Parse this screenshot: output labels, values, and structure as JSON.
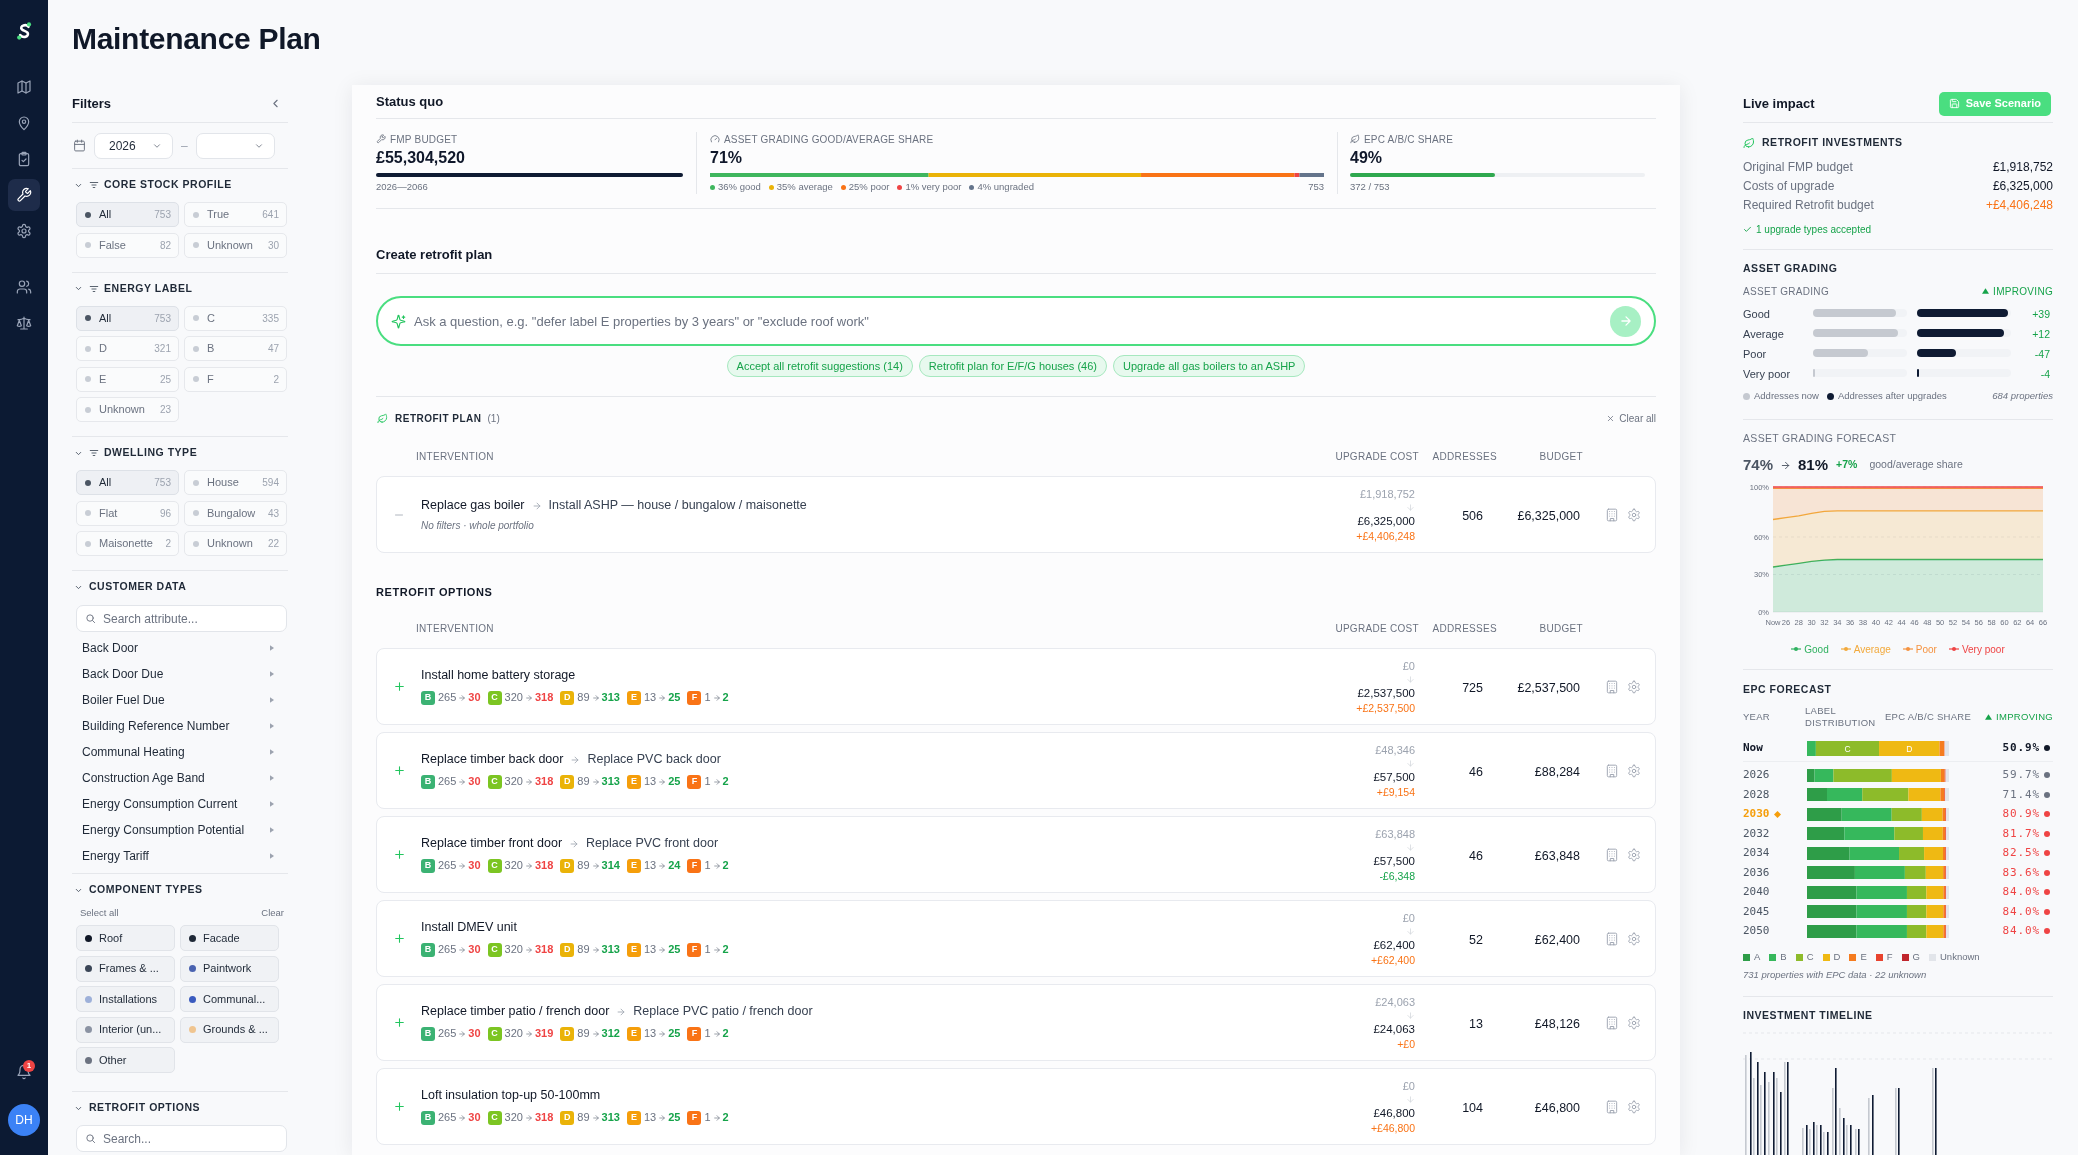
{
  "nav": {
    "groups": [
      [
        {
          "selected": false
        },
        {
          "selected": false
        },
        {
          "selected": false
        },
        {
          "selected": true
        },
        {
          "selected": false
        }
      ],
      [
        {
          "selected": false
        },
        {
          "selected": false
        }
      ]
    ],
    "notifications": "1",
    "avatar": "DH"
  },
  "page_title": "Maintenance Plan",
  "filters": {
    "title": "Filters",
    "year_from": "2026",
    "separator": "–",
    "sections": [
      {
        "kind": "chips",
        "title": "CORE STOCK PROFILE",
        "expanded": true,
        "options": [
          {
            "label": "All",
            "count": "753",
            "selected": true
          },
          {
            "label": "True",
            "count": "641",
            "selected": false
          },
          {
            "label": "False",
            "count": "82",
            "selected": false
          },
          {
            "label": "Unknown",
            "count": "30",
            "selected": false
          }
        ]
      },
      {
        "kind": "chips",
        "title": "ENERGY LABEL",
        "expanded": true,
        "options": [
          {
            "label": "All",
            "count": "753",
            "selected": true
          },
          {
            "label": "C",
            "count": "335",
            "selected": false
          },
          {
            "label": "D",
            "count": "321",
            "selected": false
          },
          {
            "label": "B",
            "count": "47",
            "selected": false
          },
          {
            "label": "E",
            "count": "25",
            "selected": false
          },
          {
            "label": "F",
            "count": "2",
            "selected": false
          },
          {
            "label": "Unknown",
            "count": "23",
            "selected": false
          }
        ]
      },
      {
        "kind": "chips",
        "title": "DWELLING TYPE",
        "expanded": true,
        "options": [
          {
            "label": "All",
            "count": "753",
            "selected": true
          },
          {
            "label": "House",
            "count": "594",
            "selected": false
          },
          {
            "label": "Flat",
            "count": "96",
            "selected": false
          },
          {
            "label": "Bungalow",
            "count": "43",
            "selected": false
          },
          {
            "label": "Maisonette",
            "count": "2",
            "selected": false
          },
          {
            "label": "Unknown",
            "count": "22",
            "selected": false
          }
        ]
      },
      {
        "kind": "attributes",
        "title": "CUSTOMER DATA",
        "expanded": true,
        "search": {
          "placeholder": "Search attribute..."
        },
        "items": [
          "Back Door",
          "Back Door Due",
          "Boiler Fuel Due",
          "Building Reference Number",
          "Communal Heating",
          "Construction Age Band",
          "Energy Consumption Current",
          "Energy Consumption Potential",
          "Energy Tariff"
        ]
      },
      {
        "kind": "components",
        "title": "COMPONENT TYPES",
        "expanded": true,
        "select_all": "Select all",
        "clear": "Clear",
        "options": [
          {
            "label": "Roof",
            "color": "#111827",
            "selected": true
          },
          {
            "label": "Facade",
            "color": "#1f2937",
            "selected": true
          },
          {
            "label": "Frames & ...",
            "color": "#3b4657",
            "selected": true
          },
          {
            "label": "Paintwork",
            "color": "#4a63b0",
            "selected": true
          },
          {
            "label": "Installations",
            "color": "#9db0d9",
            "selected": true
          },
          {
            "label": "Communal...",
            "color": "#3a5bbf",
            "selected": true
          },
          {
            "label": "Interior (un...",
            "color": "#8b93a3",
            "selected": true
          },
          {
            "label": "Grounds & ...",
            "color": "#f0c590",
            "selected": true
          },
          {
            "label": "Other",
            "color": "#6b7280",
            "selected": true
          }
        ]
      },
      {
        "kind": "search",
        "title": "RETROFIT OPTIONS",
        "expanded": true,
        "search": {
          "placeholder": "Search..."
        }
      }
    ]
  },
  "status_quo": {
    "title": "Status quo",
    "kpis": [
      {
        "kind": "budget",
        "label": "FMP BUDGET",
        "value": "£55,304,520",
        "note": "2026—2066"
      },
      {
        "kind": "grading",
        "label": "ASSET GRADING GOOD/AVERAGE SHARE",
        "value": "71%",
        "legend": [
          {
            "label": "36% good",
            "color": "#3fb65e"
          },
          {
            "label": "35% average",
            "color": "#eab308"
          },
          {
            "label": "25% poor",
            "color": "#f97316"
          },
          {
            "label": "1% very poor",
            "color": "#ef4444"
          },
          {
            "label": "4% ungraded",
            "color": "#64748b"
          }
        ],
        "total": "753"
      },
      {
        "kind": "share",
        "label": "EPC A/B/C SHARE",
        "value": "49%",
        "level": 0.49,
        "note": "372 / 753"
      }
    ]
  },
  "create_plan": {
    "title": "Create retrofit plan",
    "prompt": {
      "placeholder": "Ask a question, e.g. \"defer label E properties by 3 years\" or \"exclude roof work\""
    },
    "suggestions": [
      "Accept all retrofit suggestions (14)",
      "Retrofit plan for E/F/G houses (46)",
      "Upgrade all gas boilers to an ASHP"
    ]
  },
  "retrofit_plan": {
    "title": "RETROFIT PLAN",
    "count": "(1)",
    "clear": "Clear all",
    "columns": [
      "INTERVENTION",
      "UPGRADE COST",
      "ADDRESSES",
      "BUDGET"
    ],
    "rows": [
      {
        "accepted": true,
        "title": "Replace gas boiler",
        "replacement": "Install ASHP — house / bungalow / maisonette",
        "note": "No filters · whole portfolio",
        "cost_from": "£1,918,752",
        "cost_to": "£6,325,000",
        "delta": {
          "text": "+£4,406,248",
          "increase": true
        },
        "addresses": "506",
        "budget": "£6,325,000"
      }
    ]
  },
  "retrofit_options": {
    "title": "RETROFIT OPTIONS",
    "columns": [
      "INTERVENTION",
      "UPGRADE COST",
      "ADDRESSES",
      "BUDGET"
    ],
    "rows": [
      {
        "accepted": false,
        "title": "Install home battery storage",
        "label_changes": [
          {
            "label": "B",
            "color": "#3bb273",
            "from": "265",
            "to": "30",
            "increase": false
          },
          {
            "label": "C",
            "color": "#7cc522",
            "from": "320",
            "to": "318",
            "increase": false
          },
          {
            "label": "D",
            "color": "#eab308",
            "from": "89",
            "to": "313",
            "increase": true
          },
          {
            "label": "E",
            "color": "#f59e0b",
            "from": "13",
            "to": "25",
            "increase": true
          },
          {
            "label": "F",
            "color": "#f97316",
            "from": "1",
            "to": "2",
            "increase": true
          }
        ],
        "cost_from": "£0",
        "cost_to": "£2,537,500",
        "delta": {
          "text": "+£2,537,500",
          "increase": true
        },
        "addresses": "725",
        "budget": "£2,537,500"
      },
      {
        "accepted": false,
        "title": "Replace timber back door",
        "replacement": "Replace PVC back door",
        "label_changes": [
          {
            "label": "B",
            "color": "#3bb273",
            "from": "265",
            "to": "30",
            "increase": false
          },
          {
            "label": "C",
            "color": "#7cc522",
            "from": "320",
            "to": "318",
            "increase": false
          },
          {
            "label": "D",
            "color": "#eab308",
            "from": "89",
            "to": "313",
            "increase": true
          },
          {
            "label": "E",
            "color": "#f59e0b",
            "from": "13",
            "to": "25",
            "increase": true
          },
          {
            "label": "F",
            "color": "#f97316",
            "from": "1",
            "to": "2",
            "increase": true
          }
        ],
        "cost_from": "£48,346",
        "cost_to": "£57,500",
        "delta": {
          "text": "+£9,154",
          "increase": true
        },
        "addresses": "46",
        "budget": "£88,284"
      },
      {
        "accepted": false,
        "title": "Replace timber front door",
        "replacement": "Replace PVC front door",
        "label_changes": [
          {
            "label": "B",
            "color": "#3bb273",
            "from": "265",
            "to": "30",
            "increase": false
          },
          {
            "label": "C",
            "color": "#7cc522",
            "from": "320",
            "to": "318",
            "increase": false
          },
          {
            "label": "D",
            "color": "#eab308",
            "from": "89",
            "to": "314",
            "increase": true
          },
          {
            "label": "E",
            "color": "#f59e0b",
            "from": "13",
            "to": "24",
            "increase": true
          },
          {
            "label": "F",
            "color": "#f97316",
            "from": "1",
            "to": "2",
            "increase": true
          }
        ],
        "cost_from": "£63,848",
        "cost_to": "£57,500",
        "delta": {
          "text": "-£6,348",
          "increase": false
        },
        "addresses": "46",
        "budget": "£63,848"
      },
      {
        "accepted": false,
        "title": "Install DMEV unit",
        "label_changes": [
          {
            "label": "B",
            "color": "#3bb273",
            "from": "265",
            "to": "30",
            "increase": false
          },
          {
            "label": "C",
            "color": "#7cc522",
            "from": "320",
            "to": "318",
            "increase": false
          },
          {
            "label": "D",
            "color": "#eab308",
            "from": "89",
            "to": "313",
            "increase": true
          },
          {
            "label": "E",
            "color": "#f59e0b",
            "from": "13",
            "to": "25",
            "increase": true
          },
          {
            "label": "F",
            "color": "#f97316",
            "from": "1",
            "to": "2",
            "increase": true
          }
        ],
        "cost_from": "£0",
        "cost_to": "£62,400",
        "delta": {
          "text": "+£62,400",
          "increase": true
        },
        "addresses": "52",
        "budget": "£62,400"
      },
      {
        "accepted": false,
        "title": "Replace timber patio / french door",
        "replacement": "Replace PVC patio / french door",
        "label_changes": [
          {
            "label": "B",
            "color": "#3bb273",
            "from": "265",
            "to": "30",
            "increase": false
          },
          {
            "label": "C",
            "color": "#7cc522",
            "from": "320",
            "to": "319",
            "increase": false
          },
          {
            "label": "D",
            "color": "#eab308",
            "from": "89",
            "to": "312",
            "increase": true
          },
          {
            "label": "E",
            "color": "#f59e0b",
            "from": "13",
            "to": "25",
            "increase": true
          },
          {
            "label": "F",
            "color": "#f97316",
            "from": "1",
            "to": "2",
            "increase": true
          }
        ],
        "cost_from": "£24,063",
        "cost_to": "£24,063",
        "delta": {
          "text": "+£0",
          "increase": true
        },
        "addresses": "13",
        "budget": "£48,126"
      },
      {
        "accepted": false,
        "title": "Loft insulation top-up 50-100mm",
        "label_changes": [
          {
            "label": "B",
            "color": "#3bb273",
            "from": "265",
            "to": "30",
            "increase": false
          },
          {
            "label": "C",
            "color": "#7cc522",
            "from": "320",
            "to": "318",
            "increase": false
          },
          {
            "label": "D",
            "color": "#eab308",
            "from": "89",
            "to": "313",
            "increase": true
          },
          {
            "label": "E",
            "color": "#f59e0b",
            "from": "13",
            "to": "25",
            "increase": true
          },
          {
            "label": "F",
            "color": "#f97316",
            "from": "1",
            "to": "2",
            "increase": true
          }
        ],
        "cost_from": "£0",
        "cost_to": "£46,800",
        "delta": {
          "text": "+£46,800",
          "increase": true
        },
        "addresses": "104",
        "budget": "£46,800"
      }
    ]
  },
  "live_impact": {
    "title": "Live impact",
    "save_button": "Save Scenario",
    "investments": {
      "title": "RETROFIT INVESTMENTS",
      "rows": [
        {
          "kind": "plain",
          "label": "Original FMP budget",
          "value": "£1,918,752"
        },
        {
          "kind": "plain",
          "label": "Costs of upgrade",
          "value": "£6,325,000"
        },
        {
          "kind": "increase",
          "label": "Required Retrofit budget",
          "value": "+£4,406,248"
        }
      ],
      "note": "1 upgrade types accepted"
    },
    "asset_grading": {
      "title": "ASSET GRADING",
      "subtitle": "ASSET GRADING",
      "trend": "IMPROVING",
      "rows": [
        {
          "label": "Good",
          "now": {
            "level": 0.88
          },
          "after": {
            "level": 0.97
          },
          "delta": "+39"
        },
        {
          "label": "Average",
          "now": {
            "level": 0.9
          },
          "after": {
            "level": 0.93
          },
          "delta": "+12"
        },
        {
          "label": "Poor",
          "now": {
            "level": 0.59
          },
          "after": {
            "level": 0.42
          },
          "delta": "-47"
        },
        {
          "label": "Very poor",
          "now": {
            "level": 0.02
          },
          "after": {
            "level": 0.02
          },
          "delta": "-4"
        }
      ],
      "legend": [
        "Addresses now",
        "Addresses after upgrades"
      ],
      "properties": "684 properties"
    },
    "forecast": {
      "title": "ASSET GRADING FORECAST",
      "from": "74%",
      "to": "81%",
      "change": "+7%",
      "caption": "good/average share",
      "chart_data": {
        "type": "area",
        "stacked": true,
        "legend": "bottom",
        "categories": [
          "Now",
          "26",
          "28",
          "30",
          "32",
          "34",
          "36",
          "38",
          "40",
          "42",
          "44",
          "46",
          "48",
          "50",
          "52",
          "54",
          "56",
          "58",
          "60",
          "62",
          "64",
          "66"
        ],
        "ylim": [
          0,
          100
        ],
        "yticks": [
          {
            "value": 0,
            "label": "0%"
          },
          {
            "value": 30,
            "label": "30%"
          },
          {
            "value": 60,
            "label": "60%"
          },
          {
            "value": 100,
            "label": "100%"
          }
        ],
        "series": [
          {
            "name": "Good",
            "color": "#2fb15f",
            "values": [
              36,
              37.5,
              39,
              40.5,
              41.5,
              42,
              42,
              42,
              42,
              42,
              42,
              42,
              42,
              42,
              42,
              42,
              42,
              42,
              42,
              42,
              42,
              42
            ]
          },
          {
            "name": "Average",
            "color": "#f2a93b",
            "values": [
              38,
              38,
              38,
              38.5,
              39,
              39,
              39,
              39,
              39,
              39,
              39,
              39,
              39,
              39,
              39,
              39,
              39,
              39,
              39,
              39,
              39,
              39
            ]
          },
          {
            "name": "Poor",
            "color": "#f59340",
            "values": [
              25,
              23.5,
              22,
              20,
              18.5,
              18,
              18,
              18,
              18,
              18,
              18,
              18,
              18,
              18,
              18,
              18,
              18,
              18,
              18,
              18,
              18,
              18
            ]
          },
          {
            "name": "Very poor",
            "color": "#ef4444",
            "values": [
              1,
              1,
              1,
              1,
              1,
              1,
              1,
              1,
              1,
              1,
              1,
              1,
              1,
              1,
              1,
              1,
              1,
              1,
              1,
              1,
              1,
              1
            ]
          }
        ]
      }
    },
    "epc_forecast": {
      "title": "EPC FORECAST",
      "columns": [
        "YEAR",
        "LABEL DISTRIBUTION",
        "EPC A/B/C SHARE"
      ],
      "trend": "IMPROVING",
      "rows": [
        {
          "kind": "current",
          "year": "Now",
          "selected": false,
          "bar_labels": [
            "C",
            "D"
          ],
          "share": "50.9%",
          "color": "#111827"
        },
        {
          "kind": "forecast",
          "year": "2026",
          "selected": false,
          "share": "59.7%",
          "color": "#6b7280"
        },
        {
          "kind": "forecast",
          "year": "2028",
          "selected": false,
          "share": "71.4%",
          "color": "#6b7280"
        },
        {
          "kind": "forecast",
          "year": "2030",
          "selected": true,
          "share": "80.9%",
          "color": "#ef4444"
        },
        {
          "kind": "forecast",
          "year": "2032",
          "selected": false,
          "share": "81.7%",
          "color": "#ef4444"
        },
        {
          "kind": "forecast",
          "year": "2034",
          "selected": false,
          "share": "82.5%",
          "color": "#ef4444"
        },
        {
          "kind": "forecast",
          "year": "2036",
          "selected": false,
          "share": "83.6%",
          "color": "#ef4444"
        },
        {
          "kind": "forecast",
          "year": "2040",
          "selected": false,
          "share": "84.0%",
          "color": "#ef4444"
        },
        {
          "kind": "forecast",
          "year": "2045",
          "selected": false,
          "share": "84.0%",
          "color": "#ef4444"
        },
        {
          "kind": "forecast",
          "year": "2050",
          "selected": false,
          "share": "84.0%",
          "color": "#ef4444"
        }
      ],
      "legend": [
        {
          "label": "A",
          "color": "#2e9d48"
        },
        {
          "label": "B",
          "color": "#36b85c"
        },
        {
          "label": "C",
          "color": "#8dbb2a"
        },
        {
          "label": "D",
          "color": "#efb913"
        },
        {
          "label": "E",
          "color": "#f57c1f"
        },
        {
          "label": "F",
          "color": "#e8432e"
        },
        {
          "label": "G",
          "color": "#c0262d"
        },
        {
          "label": "Unknown",
          "color": "#e2e5ea"
        }
      ],
      "note": "731 properties with EPC data · 22 unknown"
    },
    "investment_timeline": {
      "title": "INVESTMENT TIMELINE"
    }
  }
}
